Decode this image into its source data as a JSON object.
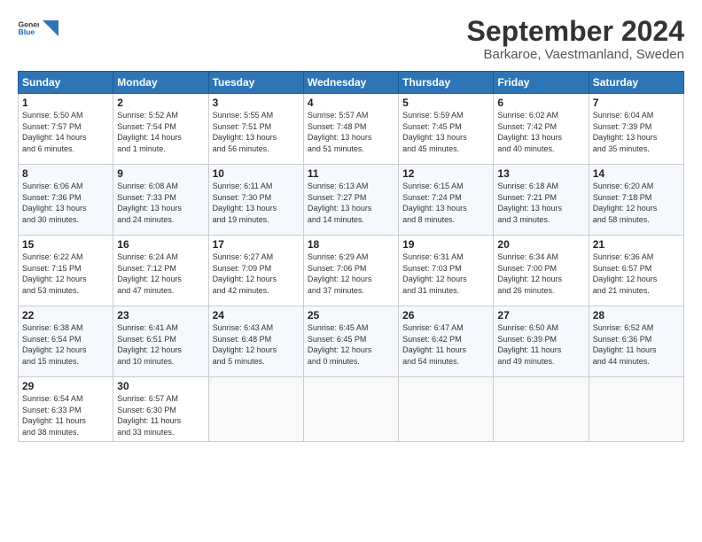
{
  "logo": {
    "general": "General",
    "blue": "Blue"
  },
  "title": "September 2024",
  "subtitle": "Barkaroe, Vaestmanland, Sweden",
  "headers": [
    "Sunday",
    "Monday",
    "Tuesday",
    "Wednesday",
    "Thursday",
    "Friday",
    "Saturday"
  ],
  "weeks": [
    [
      {
        "day": "1",
        "info": "Sunrise: 5:50 AM\nSunset: 7:57 PM\nDaylight: 14 hours\nand 6 minutes."
      },
      {
        "day": "2",
        "info": "Sunrise: 5:52 AM\nSunset: 7:54 PM\nDaylight: 14 hours\nand 1 minute."
      },
      {
        "day": "3",
        "info": "Sunrise: 5:55 AM\nSunset: 7:51 PM\nDaylight: 13 hours\nand 56 minutes."
      },
      {
        "day": "4",
        "info": "Sunrise: 5:57 AM\nSunset: 7:48 PM\nDaylight: 13 hours\nand 51 minutes."
      },
      {
        "day": "5",
        "info": "Sunrise: 5:59 AM\nSunset: 7:45 PM\nDaylight: 13 hours\nand 45 minutes."
      },
      {
        "day": "6",
        "info": "Sunrise: 6:02 AM\nSunset: 7:42 PM\nDaylight: 13 hours\nand 40 minutes."
      },
      {
        "day": "7",
        "info": "Sunrise: 6:04 AM\nSunset: 7:39 PM\nDaylight: 13 hours\nand 35 minutes."
      }
    ],
    [
      {
        "day": "8",
        "info": "Sunrise: 6:06 AM\nSunset: 7:36 PM\nDaylight: 13 hours\nand 30 minutes."
      },
      {
        "day": "9",
        "info": "Sunrise: 6:08 AM\nSunset: 7:33 PM\nDaylight: 13 hours\nand 24 minutes."
      },
      {
        "day": "10",
        "info": "Sunrise: 6:11 AM\nSunset: 7:30 PM\nDaylight: 13 hours\nand 19 minutes."
      },
      {
        "day": "11",
        "info": "Sunrise: 6:13 AM\nSunset: 7:27 PM\nDaylight: 13 hours\nand 14 minutes."
      },
      {
        "day": "12",
        "info": "Sunrise: 6:15 AM\nSunset: 7:24 PM\nDaylight: 13 hours\nand 8 minutes."
      },
      {
        "day": "13",
        "info": "Sunrise: 6:18 AM\nSunset: 7:21 PM\nDaylight: 13 hours\nand 3 minutes."
      },
      {
        "day": "14",
        "info": "Sunrise: 6:20 AM\nSunset: 7:18 PM\nDaylight: 12 hours\nand 58 minutes."
      }
    ],
    [
      {
        "day": "15",
        "info": "Sunrise: 6:22 AM\nSunset: 7:15 PM\nDaylight: 12 hours\nand 53 minutes."
      },
      {
        "day": "16",
        "info": "Sunrise: 6:24 AM\nSunset: 7:12 PM\nDaylight: 12 hours\nand 47 minutes."
      },
      {
        "day": "17",
        "info": "Sunrise: 6:27 AM\nSunset: 7:09 PM\nDaylight: 12 hours\nand 42 minutes."
      },
      {
        "day": "18",
        "info": "Sunrise: 6:29 AM\nSunset: 7:06 PM\nDaylight: 12 hours\nand 37 minutes."
      },
      {
        "day": "19",
        "info": "Sunrise: 6:31 AM\nSunset: 7:03 PM\nDaylight: 12 hours\nand 31 minutes."
      },
      {
        "day": "20",
        "info": "Sunrise: 6:34 AM\nSunset: 7:00 PM\nDaylight: 12 hours\nand 26 minutes."
      },
      {
        "day": "21",
        "info": "Sunrise: 6:36 AM\nSunset: 6:57 PM\nDaylight: 12 hours\nand 21 minutes."
      }
    ],
    [
      {
        "day": "22",
        "info": "Sunrise: 6:38 AM\nSunset: 6:54 PM\nDaylight: 12 hours\nand 15 minutes."
      },
      {
        "day": "23",
        "info": "Sunrise: 6:41 AM\nSunset: 6:51 PM\nDaylight: 12 hours\nand 10 minutes."
      },
      {
        "day": "24",
        "info": "Sunrise: 6:43 AM\nSunset: 6:48 PM\nDaylight: 12 hours\nand 5 minutes."
      },
      {
        "day": "25",
        "info": "Sunrise: 6:45 AM\nSunset: 6:45 PM\nDaylight: 12 hours\nand 0 minutes."
      },
      {
        "day": "26",
        "info": "Sunrise: 6:47 AM\nSunset: 6:42 PM\nDaylight: 11 hours\nand 54 minutes."
      },
      {
        "day": "27",
        "info": "Sunrise: 6:50 AM\nSunset: 6:39 PM\nDaylight: 11 hours\nand 49 minutes."
      },
      {
        "day": "28",
        "info": "Sunrise: 6:52 AM\nSunset: 6:36 PM\nDaylight: 11 hours\nand 44 minutes."
      }
    ],
    [
      {
        "day": "29",
        "info": "Sunrise: 6:54 AM\nSunset: 6:33 PM\nDaylight: 11 hours\nand 38 minutes."
      },
      {
        "day": "30",
        "info": "Sunrise: 6:57 AM\nSunset: 6:30 PM\nDaylight: 11 hours\nand 33 minutes."
      },
      {
        "day": "",
        "info": ""
      },
      {
        "day": "",
        "info": ""
      },
      {
        "day": "",
        "info": ""
      },
      {
        "day": "",
        "info": ""
      },
      {
        "day": "",
        "info": ""
      }
    ]
  ]
}
